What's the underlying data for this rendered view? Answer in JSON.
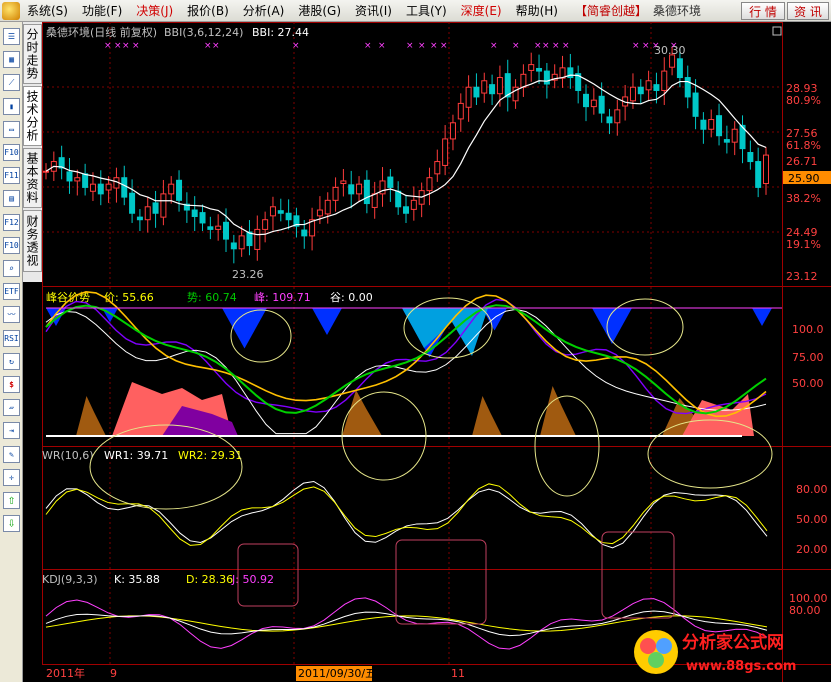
{
  "menu": {
    "items": [
      "系统(S)",
      "功能(F)",
      "决策(J)",
      "报价(B)",
      "分析(A)",
      "港股(G)",
      "资讯(I)",
      "工具(Y)",
      "深度(E)",
      "帮助(H)"
    ],
    "active_index": 2,
    "brand": "【简睿创越】",
    "stock": "桑德环境",
    "quote_btn": "行 情",
    "info_btn": "资 讯"
  },
  "tabs": [
    "分时走势",
    "技术分析",
    "基本资料",
    "财务透视"
  ],
  "active_tab": 1,
  "toolbar_icons": [
    "list-icon",
    "grid-icon",
    "line-chart-icon",
    "candle-icon",
    "window-icon",
    "F10",
    "F11",
    "news-icon",
    "F12",
    "F10b",
    "search-icon",
    "ETF",
    "trend-icon",
    "RSI",
    "refresh-icon",
    "dollar-icon",
    "eraser-icon",
    "export-icon",
    "pencil-icon",
    "cross-icon",
    "up-arrow-icon",
    "down-arrow-icon"
  ],
  "main_panel": {
    "title": "桑德环境(日线 前复权)",
    "indicator": "BBI(3,6,12,24)",
    "bbi_label": "BBI: 27.44",
    "high_marker": "30.30",
    "low_marker": "23.26",
    "price_ticks": [
      "28.93",
      "80.9%",
      "27.56",
      "61.8%",
      "26.71",
      "25.90",
      "38.2%",
      "24.49",
      "19.1%",
      "23.12"
    ],
    "current_price": "25.90"
  },
  "fg_panel": {
    "title": "峰谷价势",
    "price_label": "价: 55.66",
    "yellow_label": "势: 60.74",
    "red_label": "峰: 109.71",
    "valley_label": "谷: 0.00",
    "ticks": [
      "100.0",
      "75.00",
      "50.00"
    ]
  },
  "wr_panel": {
    "title": "WR(10,6)",
    "wr1": "WR1: 39.71",
    "wr2": "WR2: 29.31",
    "ticks": [
      "80.00",
      "50.00",
      "20.00"
    ]
  },
  "kdj_panel": {
    "title": "KDJ(9,3,3)",
    "k": "K: 35.88",
    "d": "D: 28.36",
    "j": "J: 50.92",
    "ticks": [
      "100.00",
      "80.00"
    ]
  },
  "date_bar": {
    "year": "2011年",
    "month1": "9",
    "selected_date": "2011/09/30/五",
    "month2": "11"
  },
  "watermark": {
    "title": "分析家公式网",
    "url": "www.88gs.com"
  },
  "colors": {
    "up": "#ff3c3c",
    "down": "#00c8c8",
    "bbi": "#ffffff",
    "grid": "#800000",
    "highlight": "#ff8c00"
  },
  "chart_data": {
    "type": "line",
    "x_range": [
      "2011/07",
      "2011/12"
    ],
    "price_range": [
      23.12,
      30.3
    ],
    "bbi_last": 27.44,
    "current_price": 25.9
  }
}
